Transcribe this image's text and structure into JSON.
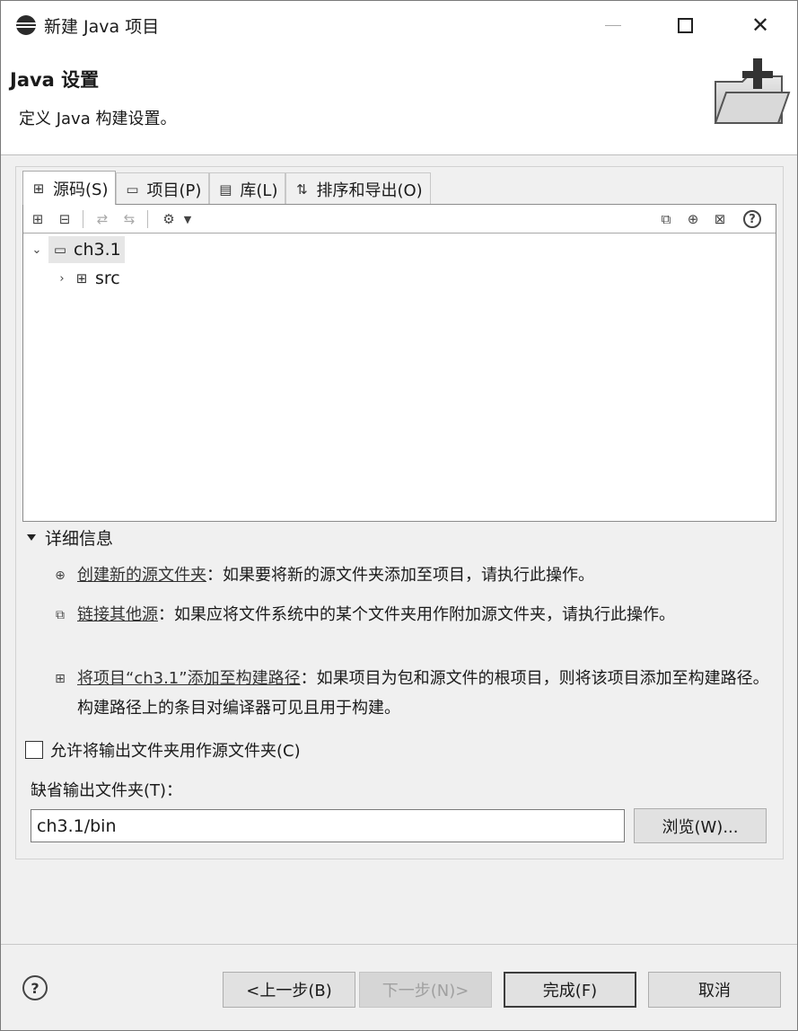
{
  "window": {
    "title": "新建 Java 项目"
  },
  "banner": {
    "title": "Java 设置",
    "description": "定义 Java 构建设置。"
  },
  "tabs": [
    {
      "label": "源码(S)",
      "icon": "source-folder-icon",
      "active": true
    },
    {
      "label": "项目(P)",
      "icon": "project-folder-icon",
      "active": false
    },
    {
      "label": "库(L)",
      "icon": "library-icon",
      "active": false
    },
    {
      "label": "排序和导出(O)",
      "icon": "order-export-icon",
      "active": false
    }
  ],
  "tree": {
    "project": "ch3.1",
    "children": [
      {
        "label": "src"
      }
    ]
  },
  "details": {
    "header": "详细信息",
    "items": [
      {
        "link": "创建新的源文件夹",
        "text": "：如果要将新的源文件夹添加至项目，请执行此操作。"
      },
      {
        "link": "链接其他源",
        "text": "：如果应将文件系统中的某个文件夹用作附加源文件夹，请执行此操作。"
      },
      {
        "link": "将项目“ch3.1”添加至构建路径",
        "text": "：如果项目为包和源文件的根项目，则将该项目添加至构建路径。构建路径上的条目对编译器可见且用于构建。"
      }
    ]
  },
  "output": {
    "allow_checkbox_label": "允许将输出文件夹用作源文件夹(C)",
    "allow_checked": false,
    "default_folder_label": "缺省输出文件夹(T)：",
    "default_folder_value": "ch3.1/bin",
    "browse_label": "浏览(W)..."
  },
  "buttons": {
    "back": "<上一步(B)",
    "next": "下一步(N)>",
    "finish": "完成(F)",
    "cancel": "取消"
  }
}
